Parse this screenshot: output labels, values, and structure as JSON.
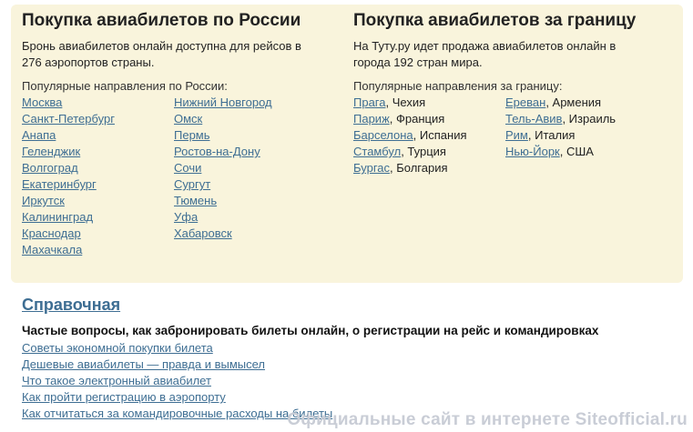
{
  "russia": {
    "title": "Покупка авиабилетов по России",
    "description": "Бронь авиабилетов онлайн доступна для рейсов в 276 аэропортов страны.",
    "popular_label": "Популярные направления по России:",
    "cities_col1": [
      "Москва",
      "Санкт-Петербург",
      "Анапа",
      "Геленджик",
      "Волгоград",
      "Екатеринбург",
      "Иркутск",
      "Калининград",
      "Краснодар",
      "Махачкала"
    ],
    "cities_col2": [
      "Нижний Новгород",
      "Омск",
      "Пермь",
      "Ростов-на-Дону",
      "Сочи",
      "Сургут",
      "Тюмень",
      "Уфа",
      "Хабаровск"
    ]
  },
  "abroad": {
    "title": "Покупка авиабилетов за границу",
    "description": "На Туту.ру идет продажа авиабилетов онлайн в города 192 стран мира.",
    "popular_label": "Популярные направления за границу:",
    "cities_col1": [
      {
        "city": "Прага",
        "country": ", Чехия"
      },
      {
        "city": "Париж",
        "country": ", Франция"
      },
      {
        "city": "Барселона",
        "country": ", Испания"
      },
      {
        "city": "Стамбул",
        "country": ", Турция"
      },
      {
        "city": "Бургас",
        "country": ", Болгария"
      }
    ],
    "cities_col2": [
      {
        "city": "Ереван",
        "country": ", Армения"
      },
      {
        "city": "Тель-Авив",
        "country": ", Израиль"
      },
      {
        "city": "Рим",
        "country": ", Италия"
      },
      {
        "city": "Нью-Йорк",
        "country": ", США"
      }
    ]
  },
  "reference": {
    "title": "Справочная",
    "faq_heading": "Частые вопросы, как забронировать билеты онлайн, о регистрации на рейс и командировках",
    "links": [
      "Советы экономной покупки билета",
      "Дешевые авиабилеты — правда и вымысел",
      "Что такое электронный авиабилет",
      "Как пройти регистрацию в аэропорту",
      "Как отчитаться за командировочные расходы на билеты"
    ]
  },
  "watermark": "Официальные сайт в интернете Siteofficial.ru",
  "colors": {
    "panel_background": "#f9f4dc",
    "link": "#3e6e93",
    "text": "#222222",
    "watermark": "#c9cdd6"
  }
}
